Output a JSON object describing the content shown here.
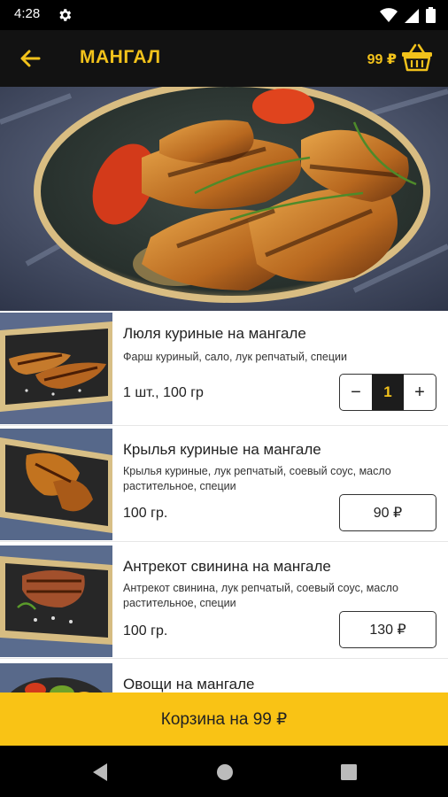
{
  "status_bar": {
    "time": "4:28"
  },
  "app_bar": {
    "title": "МАНГАЛ",
    "cart_total": "99 ₽"
  },
  "products": [
    {
      "name": "Люля куриные на мангале",
      "description": "Фарш куриный, сало, лук репчатый, специи",
      "weight": "1 шт., 100 гр",
      "in_cart": true,
      "quantity": "1",
      "minus_label": "−",
      "plus_label": "+"
    },
    {
      "name": "Крылья куриные на мангале",
      "description": "Крылья куриные, лук репчатый, соевый соус, масло растительное, специи",
      "weight": "100 гр.",
      "in_cart": false,
      "price": "90 ₽"
    },
    {
      "name": "Антрекот свинина на мангале",
      "description": "Антрекот свинина, лук репчатый, соевый соус, масло растительное, специи",
      "weight": "100 гр.",
      "in_cart": false,
      "price": "130 ₽"
    },
    {
      "name": "Овощи на мангале"
    }
  ],
  "basket_bar": {
    "label": "Корзина на 99 ₽"
  },
  "colors": {
    "accent": "#f2c21b",
    "basket_bar": "#f9c315",
    "app_bar": "#121212"
  },
  "icons": [
    "settings-gear-icon",
    "wifi-icon",
    "cellular-signal-icon",
    "battery-icon",
    "back-arrow-icon",
    "shopping-basket-icon",
    "nav-back-icon",
    "nav-home-icon",
    "nav-recents-icon"
  ]
}
